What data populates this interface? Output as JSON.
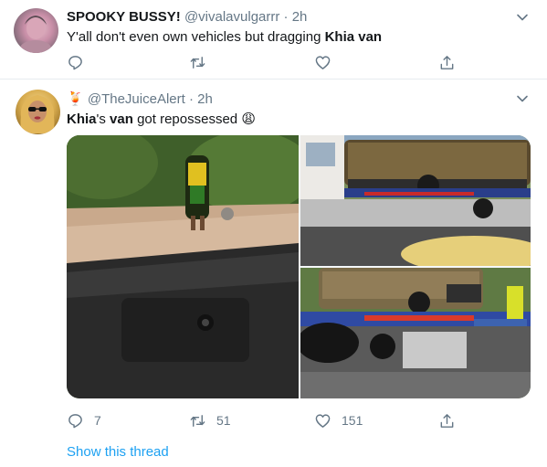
{
  "tweets": [
    {
      "display_name": "SPOOKY BUSSY!",
      "handle": "@vivalavulgarrr",
      "time": "2h",
      "text_parts": [
        "Y'all don't even own vehicles but dragging ",
        "Khia van"
      ],
      "replies": "",
      "retweets": "",
      "likes": ""
    },
    {
      "display_name_emoji": "🍹",
      "handle": "@TheJuiceAlert",
      "time": "2h",
      "text_parts": [
        "Khia",
        "'s ",
        "van",
        " got repossessed ",
        "😩"
      ],
      "replies": "7",
      "retweets": "51",
      "likes": "151",
      "show_thread": "Show this thread"
    }
  ],
  "separator": "·",
  "colors": {
    "accent": "#1da1f2",
    "muted": "#657786",
    "border": "#e6ecf0"
  },
  "icons": [
    "chevron-down-icon",
    "reply-icon",
    "retweet-icon",
    "like-icon",
    "share-icon"
  ]
}
